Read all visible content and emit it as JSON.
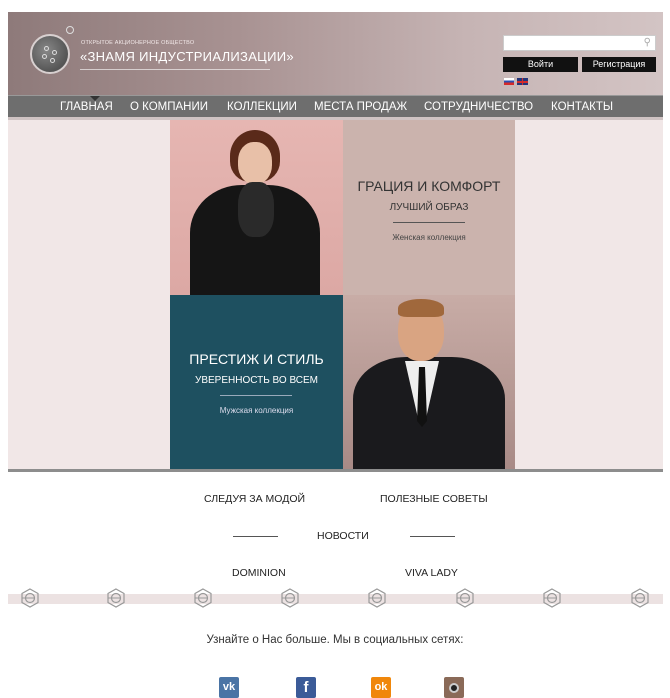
{
  "header": {
    "company_type": "ОТКРЫТОЕ АКЦИОНЕРНОЕ ОБЩЕСТВО",
    "company_name": "«ЗНАМЯ ИНДУСТРИАЛИЗАЦИИ»",
    "search_placeholder": "",
    "search_icon": "search-icon",
    "login_label": "Войти",
    "register_label": "Регистрация",
    "languages": [
      "ru-flag",
      "en-flag"
    ]
  },
  "nav": {
    "items": [
      "ГЛАВНАЯ",
      "О КОМПАНИИ",
      "КОЛЛЕКЦИИ",
      "МЕСТА ПРОДАЖ",
      "СОТРУДНИЧЕСТВО",
      "КОНТАКТЫ"
    ],
    "active": "ГЛАВНАЯ"
  },
  "hero": {
    "women": {
      "title": "ГРАЦИЯ И КОМФОРТ",
      "subtitle": "ЛУЧШИЙ ОБРАЗ",
      "link": "Женская коллекция"
    },
    "men": {
      "title": "ПРЕСТИЖ И СТИЛЬ",
      "subtitle": "УВЕРЕННОСТЬ ВО ВСЕМ",
      "link": "Мужская коллекция"
    }
  },
  "links": {
    "fashion": "СЛЕДУЯ ЗА МОДОЙ",
    "tips": "ПОЛЕЗНЫЕ СОВЕТЫ",
    "news": "НОВОСТИ",
    "dominion": "DOMINION",
    "viva_lady": "VIVA LADY"
  },
  "social": {
    "text": "Узнайте о Нас больше. Мы в социальных сетях:",
    "vk_label": "vk",
    "fb_label": "f",
    "ok_label": "ok",
    "icons": [
      "vk-icon",
      "facebook-icon",
      "odnoklassniki-icon",
      "instagram-icon"
    ]
  },
  "colors": {
    "nav_bg": "#6e6e6e",
    "women_panel": "#cbb3ad",
    "men_panel": "#1e5060",
    "hero_bg": "#f1e7e7"
  }
}
